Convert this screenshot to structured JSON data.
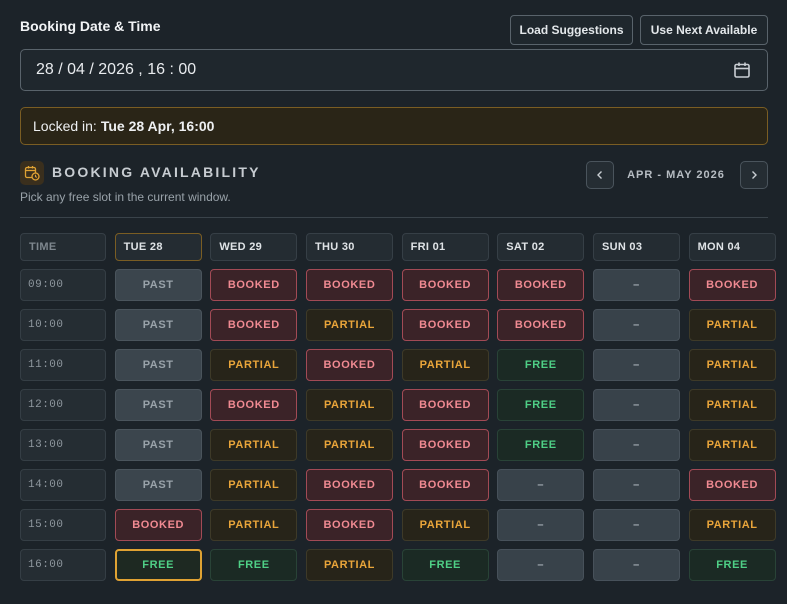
{
  "header": {
    "title": "Booking Date & Time",
    "load_label": "Load Suggestions",
    "next_label": "Use Next Available"
  },
  "datetime_input": {
    "value": "28 / 04 / 2026 ,  16 : 00",
    "icon": "calendar-icon"
  },
  "locked": {
    "prefix": "Locked in:",
    "value": "Tue 28 Apr, 16:00"
  },
  "availability": {
    "title": "BOOKING AVAILABILITY",
    "subtitle": "Pick any free slot in the current window.",
    "range_label": "APR - MAY 2026",
    "prev_icon": "chevron-left-icon",
    "next_icon": "chevron-right-icon"
  },
  "grid": {
    "time_header": "TIME",
    "days": [
      "TUE 28",
      "WED 29",
      "THU 30",
      "FRI 01",
      "SAT 02",
      "SUN 03",
      "MON 04"
    ],
    "today_index": 0,
    "rows": [
      {
        "time": "09:00",
        "slots": [
          "PAST",
          "BOOKED",
          "BOOKED",
          "BOOKED",
          "BOOKED",
          "–",
          "BOOKED"
        ]
      },
      {
        "time": "10:00",
        "slots": [
          "PAST",
          "BOOKED",
          "PARTIAL",
          "BOOKED",
          "BOOKED",
          "–",
          "PARTIAL"
        ]
      },
      {
        "time": "11:00",
        "slots": [
          "PAST",
          "PARTIAL",
          "BOOKED",
          "PARTIAL",
          "FREE",
          "–",
          "PARTIAL"
        ]
      },
      {
        "time": "12:00",
        "slots": [
          "PAST",
          "BOOKED",
          "PARTIAL",
          "BOOKED",
          "FREE",
          "–",
          "PARTIAL"
        ]
      },
      {
        "time": "13:00",
        "slots": [
          "PAST",
          "PARTIAL",
          "PARTIAL",
          "BOOKED",
          "FREE",
          "–",
          "PARTIAL"
        ]
      },
      {
        "time": "14:00",
        "slots": [
          "PAST",
          "PARTIAL",
          "BOOKED",
          "BOOKED",
          "–",
          "–",
          "BOOKED"
        ]
      },
      {
        "time": "15:00",
        "slots": [
          "BOOKED",
          "PARTIAL",
          "BOOKED",
          "PARTIAL",
          "–",
          "–",
          "PARTIAL"
        ]
      },
      {
        "time": "16:00",
        "slots": [
          "FREE",
          "FREE",
          "PARTIAL",
          "FREE",
          "–",
          "–",
          "FREE"
        ]
      }
    ],
    "selected": {
      "row": 7,
      "col": 0
    }
  },
  "colors": {
    "background": "#1c2329",
    "accent": "#e0a233",
    "booked": "#f08a92",
    "partial": "#e9a53a",
    "free": "#4fcf86"
  }
}
